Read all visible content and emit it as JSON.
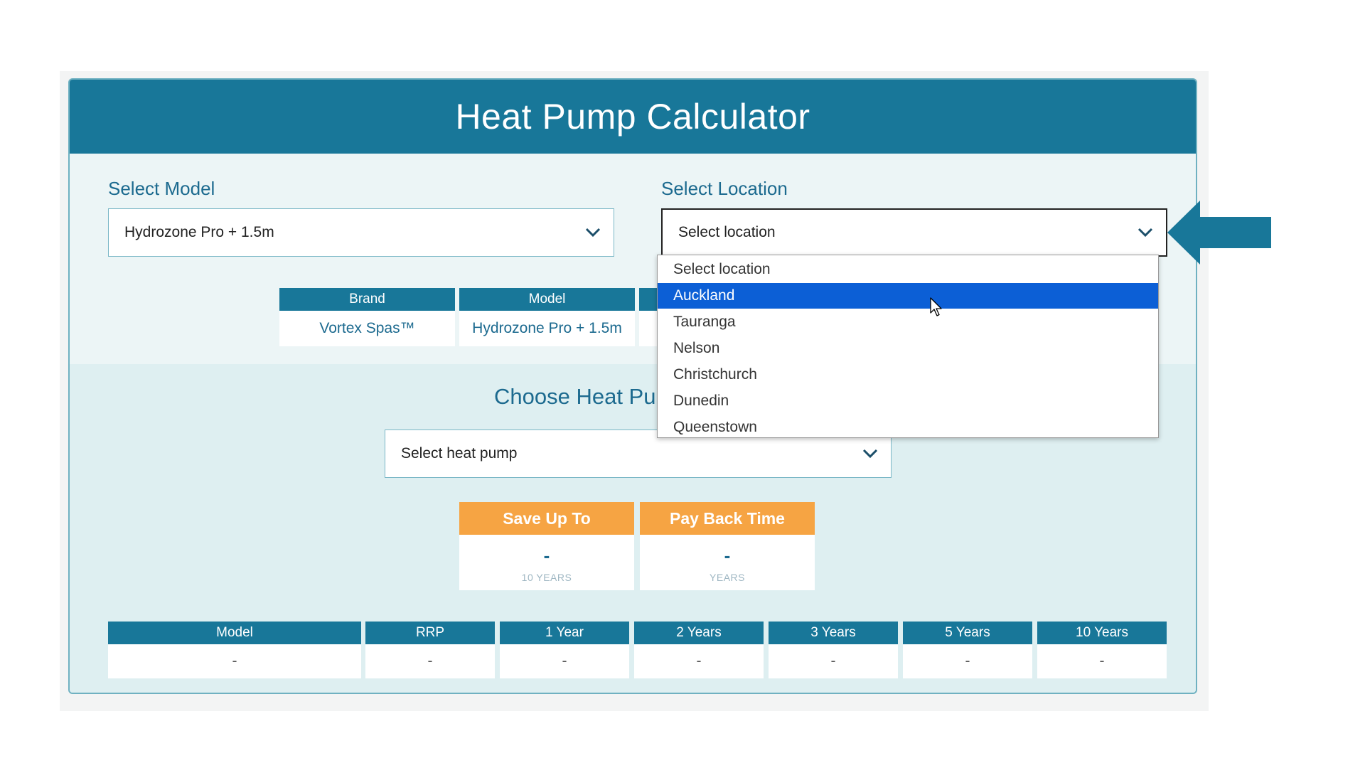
{
  "calculator": {
    "title": "Heat Pump Calculator",
    "model_label": "Select Model",
    "model_value": "Hydrozone Pro + 1.5m",
    "location_label": "Select Location",
    "location_value": "Select location"
  },
  "info_table": {
    "headers": [
      "Brand",
      "Model"
    ],
    "values": [
      "Vortex Spas™",
      "Hydrozone Pro + 1.5m"
    ]
  },
  "heat_pump": {
    "label": "Choose Heat Pu",
    "placeholder": "Select heat pump"
  },
  "results": [
    {
      "title": "Save Up To",
      "value": "-",
      "unit": "10 YEARS"
    },
    {
      "title": "Pay Back Time",
      "value": "-",
      "unit": "YEARS"
    }
  ],
  "summary_table": {
    "headers": [
      "Model",
      "RRP",
      "1 Year",
      "2 Years",
      "3 Years",
      "5 Years",
      "10 Years"
    ],
    "values": [
      "-",
      "-",
      "-",
      "-",
      "-",
      "-",
      "-"
    ]
  },
  "location_dropdown": {
    "options": [
      "Select location",
      "Auckland",
      "Tauranga",
      "Nelson",
      "Christchurch",
      "Dunedin",
      "Queenstown"
    ],
    "highlighted": "Auckland"
  },
  "colors": {
    "header": "#187799",
    "accent_orange": "#f6a443",
    "highlight_blue": "#0c5fd6",
    "arrow": "#187799"
  },
  "icons": {
    "dropdown": "chevron-down-icon",
    "pointer": "mouse-cursor-icon",
    "annotation": "arrow-left-icon"
  }
}
